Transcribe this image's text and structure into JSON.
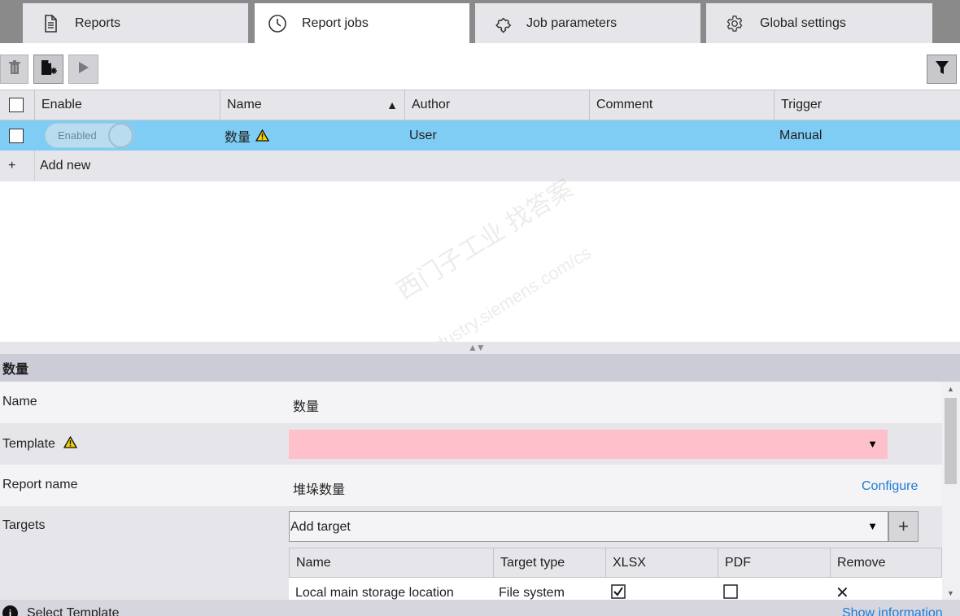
{
  "tabs": [
    {
      "label": "Reports",
      "icon": "report-document-icon"
    },
    {
      "label": "Report jobs",
      "icon": "clock-icon",
      "active": true
    },
    {
      "label": "Job parameters",
      "icon": "puzzle-icon"
    },
    {
      "label": "Global settings",
      "icon": "gear-icon"
    }
  ],
  "toolbar": {
    "delete_icon": "trash-icon",
    "new_icon": "new-document-icon",
    "run_icon": "play-icon",
    "filter_icon": "filter-icon"
  },
  "grid": {
    "columns": [
      "Enable",
      "Name",
      "Author",
      "Comment",
      "Trigger"
    ],
    "sort_indicator": "▲",
    "rows": [
      {
        "enable": "Enabled",
        "name": "数量",
        "author": "User",
        "comment": "",
        "trigger": "Manual",
        "warning": true
      }
    ],
    "add_new": "Add new",
    "add_symbol": "+"
  },
  "splitter_arrows": "▲▼",
  "detail": {
    "title": "数量",
    "name_label": "Name",
    "name_value": "数量",
    "template_label": "Template",
    "template_value": "",
    "report_name_label": "Report name",
    "report_name_value": "堆垛数量",
    "configure": "Configure",
    "targets_label": "Targets",
    "add_target": "Add target",
    "add_target_plus": "+",
    "targets_columns": [
      "Name",
      "Target type",
      "XLSX",
      "PDF",
      "Remove"
    ],
    "targets_rows": [
      {
        "name": "Local main storage location",
        "type": "File system",
        "xlsx": true,
        "pdf": false,
        "remove": "✕"
      }
    ]
  },
  "status": {
    "info_symbol": "i",
    "text": "Select Template",
    "show_info": "Show information"
  },
  "colors": {
    "selected_row": "#7fcdf5",
    "error_field": "#fec0cb",
    "link": "#1f7bd6",
    "warning": "#f5d000"
  },
  "watermark": {
    "line1": "西门子工业  找答案",
    "line2": "support.industry.siemens.com/cs"
  }
}
